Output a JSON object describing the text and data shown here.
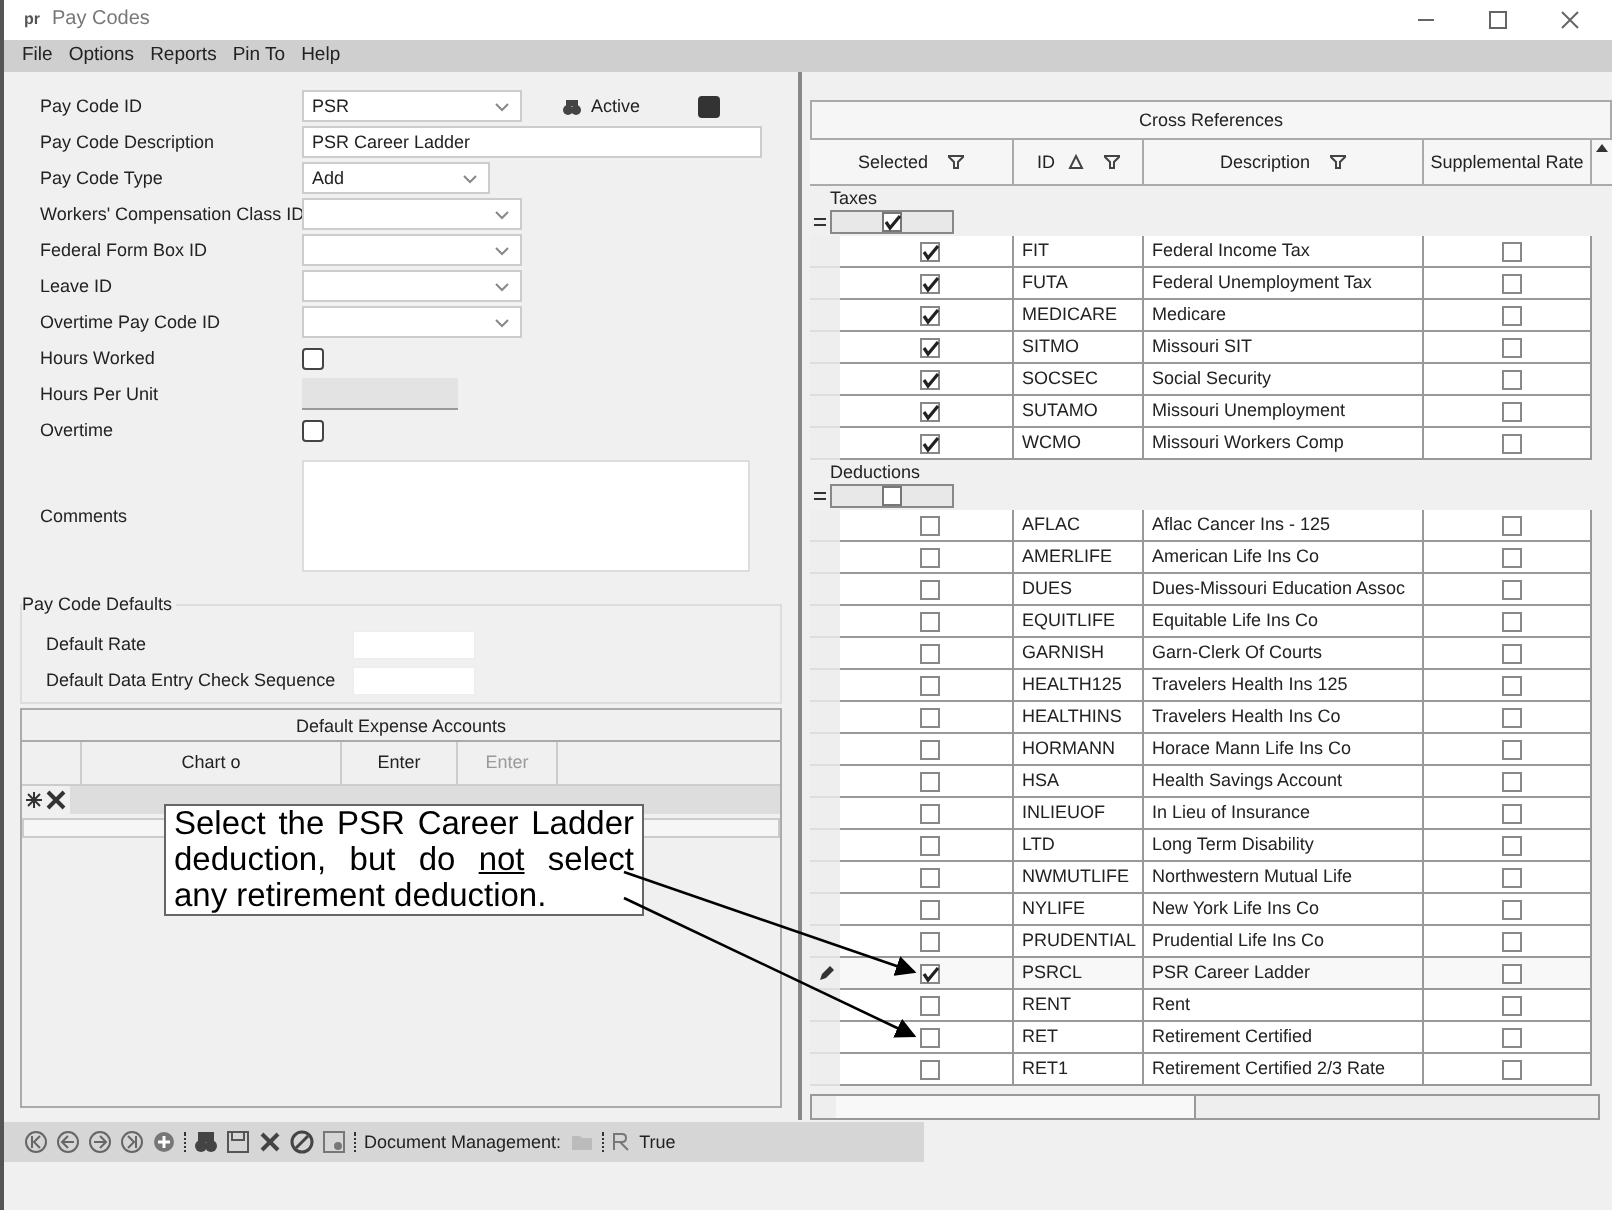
{
  "window": {
    "title": "Pay Codes",
    "logo": "pr"
  },
  "menu": [
    "File",
    "Options",
    "Reports",
    "Pin To",
    "Help"
  ],
  "form": {
    "fields": [
      {
        "label": "Pay Code ID",
        "kind": "combo",
        "value": "PSR"
      },
      {
        "label": "Pay Code Description",
        "kind": "text",
        "value": "PSR Career Ladder"
      },
      {
        "label": "Pay Code Type",
        "kind": "combo",
        "value": "Add"
      },
      {
        "label": "Workers' Compensation Class ID",
        "kind": "combo"
      },
      {
        "label": "Federal Form Box ID",
        "kind": "combo"
      },
      {
        "label": "Leave ID",
        "kind": "combo"
      },
      {
        "label": "Overtime Pay Code ID",
        "kind": "combo"
      },
      {
        "label": "Hours Worked",
        "kind": "checkbox",
        "checked": false
      },
      {
        "label": "Hours Per Unit",
        "kind": "disabled"
      },
      {
        "label": "Overtime",
        "kind": "checkbox",
        "checked": false
      },
      {
        "label": "Comments",
        "kind": "textarea"
      }
    ],
    "active": {
      "label": "Active",
      "checked": true
    }
  },
  "defaults": {
    "title": "Pay Code Defaults",
    "fields": [
      "Default Rate",
      "Default Data Entry Check Sequence"
    ]
  },
  "expense_grid": {
    "title": "Default Expense Accounts",
    "columns": [
      {
        "label": "Chart o",
        "disabled": false
      },
      {
        "label": "Enter",
        "disabled": false
      },
      {
        "label": "Enter",
        "disabled": true
      }
    ]
  },
  "cross_references": {
    "title": "Cross References",
    "columns": [
      {
        "label": "Selected",
        "sort": false
      },
      {
        "label": "ID",
        "sort": true
      },
      {
        "label": "Description",
        "sort": false
      },
      {
        "label": "Supplemental Rate",
        "sort": false
      }
    ],
    "groups": [
      {
        "name": "Taxes",
        "checked": true,
        "expanded": true,
        "rows": [
          {
            "selected": true,
            "id": "FIT",
            "description": "Federal Income Tax",
            "supplemental": false,
            "editing": false
          },
          {
            "selected": true,
            "id": "FUTA",
            "description": "Federal Unemployment Tax",
            "supplemental": false,
            "editing": false
          },
          {
            "selected": true,
            "id": "MEDICARE",
            "description": "Medicare",
            "supplemental": false,
            "editing": false
          },
          {
            "selected": true,
            "id": "SITMO",
            "description": "Missouri SIT",
            "supplemental": false,
            "editing": false
          },
          {
            "selected": true,
            "id": "SOCSEC",
            "description": "Social Security",
            "supplemental": false,
            "editing": false
          },
          {
            "selected": true,
            "id": "SUTAMO",
            "description": "Missouri Unemployment",
            "supplemental": false,
            "editing": false
          },
          {
            "selected": true,
            "id": "WCMO",
            "description": "Missouri Workers Comp",
            "supplemental": false,
            "editing": false
          }
        ]
      },
      {
        "name": "Deductions",
        "checked": false,
        "expanded": true,
        "rows": [
          {
            "selected": false,
            "id": "AFLAC",
            "description": "Aflac Cancer Ins - 125",
            "supplemental": false,
            "editing": false
          },
          {
            "selected": false,
            "id": "AMERLIFE",
            "description": "American Life Ins Co",
            "supplemental": false,
            "editing": false
          },
          {
            "selected": false,
            "id": "DUES",
            "description": "Dues-Missouri Education Assoc",
            "supplemental": false,
            "editing": false
          },
          {
            "selected": false,
            "id": "EQUITLIFE",
            "description": "Equitable Life Ins Co",
            "supplemental": false,
            "editing": false
          },
          {
            "selected": false,
            "id": "GARNISH",
            "description": "Garn-Clerk Of Courts",
            "supplemental": false,
            "editing": false
          },
          {
            "selected": false,
            "id": "HEALTH125",
            "description": "Travelers Health Ins 125",
            "supplemental": false,
            "editing": false
          },
          {
            "selected": false,
            "id": "HEALTHINS",
            "description": "Travelers Health Ins Co",
            "supplemental": false,
            "editing": false
          },
          {
            "selected": false,
            "id": "HORMANN",
            "description": "Horace Mann Life Ins Co",
            "supplemental": false,
            "editing": false
          },
          {
            "selected": false,
            "id": "HSA",
            "description": "Health Savings Account",
            "supplemental": false,
            "editing": false
          },
          {
            "selected": false,
            "id": "INLIEUOF",
            "description": "In Lieu of Insurance",
            "supplemental": false,
            "editing": false
          },
          {
            "selected": false,
            "id": "LTD",
            "description": "Long Term Disability",
            "supplemental": false,
            "editing": false
          },
          {
            "selected": false,
            "id": "NWMUTLIFE",
            "description": "Northwestern Mutual Life",
            "supplemental": false,
            "editing": false
          },
          {
            "selected": false,
            "id": "NYLIFE",
            "description": "New York Life Ins Co",
            "supplemental": false,
            "editing": false
          },
          {
            "selected": false,
            "id": "PRUDENTIAL",
            "description": "Prudential Life Ins Co",
            "supplemental": false,
            "editing": false
          },
          {
            "selected": true,
            "id": "PSRCL",
            "description": "PSR Career Ladder",
            "supplemental": false,
            "editing": true
          },
          {
            "selected": false,
            "id": "RENT",
            "description": "Rent",
            "supplemental": false,
            "editing": false
          },
          {
            "selected": false,
            "id": "RET",
            "description": "Retirement Certified",
            "supplemental": false,
            "editing": false
          },
          {
            "selected": false,
            "id": "RET1",
            "description": "Retirement Certified 2/3 Rate",
            "supplemental": false,
            "editing": false
          }
        ]
      }
    ]
  },
  "toolbar": {
    "document_label": "Document Management:",
    "status": "True"
  },
  "callout": {
    "before": "Select the PSR Career Ladder deduction, but do",
    "emphasis": "not",
    "after": "select any retirement deduction."
  }
}
